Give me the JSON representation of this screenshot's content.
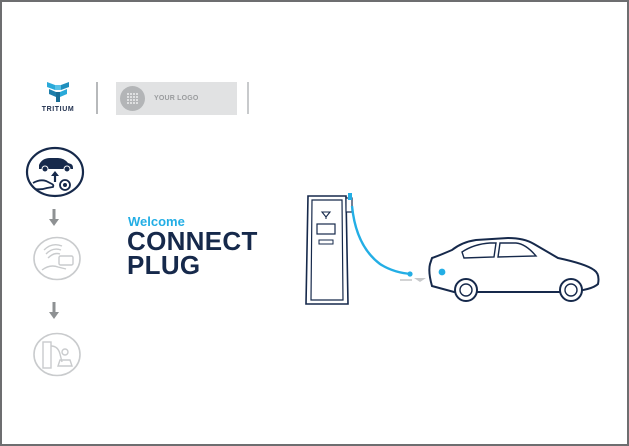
{
  "brand": {
    "name": "TRITIUM",
    "primary_color": "#16294b",
    "accent_color": "#23aee5"
  },
  "logo_placeholder": {
    "text": "YOUR LOGO"
  },
  "steps": [
    {
      "icon": "plug-car-icon",
      "state": "active"
    },
    {
      "icon": "tap-card-icon",
      "state": "inactive"
    },
    {
      "icon": "charging-icon",
      "state": "inactive"
    }
  ],
  "headline": {
    "welcome": "Welcome",
    "line1": "CONNECT",
    "line2": "PLUG"
  }
}
